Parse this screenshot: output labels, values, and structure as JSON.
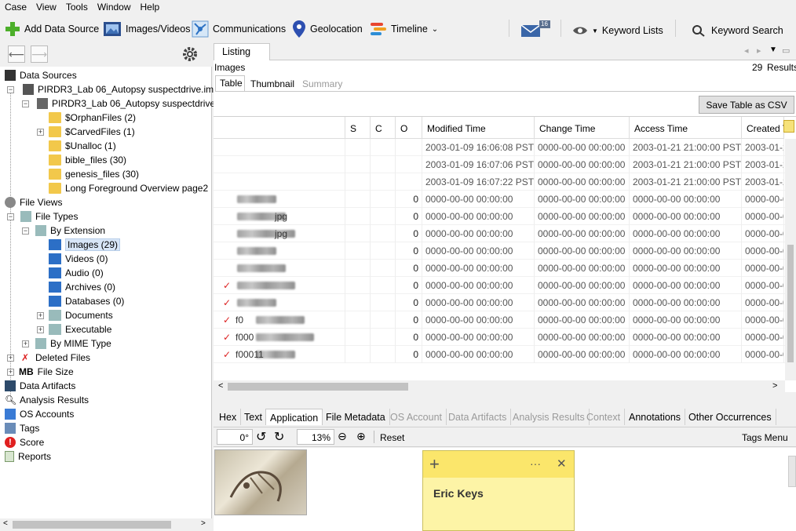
{
  "menu": [
    "Case",
    "View",
    "Tools",
    "Window",
    "Help"
  ],
  "toolbar": {
    "add_data_source": "Add Data Source",
    "images_videos": "Images/Videos",
    "communications": "Communications",
    "geolocation": "Geolocation",
    "timeline": "Timeline",
    "mail_badge": "16",
    "keyword_lists": "Keyword Lists",
    "keyword_search": "Keyword Search"
  },
  "tree": {
    "data_sources": "Data Sources",
    "image_file": "PIRDR3_Lab 06_Autopsy suspectdrive.img",
    "volume": "PIRDR3_Lab 06_Autopsy suspectdrive.i",
    "orphan": "$OrphanFiles (2)",
    "carved": "$CarvedFiles (1)",
    "unalloc": "$Unalloc (1)",
    "bible": "bible_files (30)",
    "genesis": "genesis_files (30)",
    "long_fg": "Long Foreground Overview page2",
    "file_views": "File Views",
    "file_types": "File Types",
    "by_extension": "By Extension",
    "images": "Images (29)",
    "videos": "Videos (0)",
    "audio": "Audio (0)",
    "archives": "Archives (0)",
    "databases": "Databases (0)",
    "documents": "Documents",
    "executable": "Executable",
    "by_mime": "By MIME Type",
    "deleted_files": "Deleted Files",
    "mb": "MB",
    "file_size": "File Size",
    "data_artifacts": "Data Artifacts",
    "analysis_results": "Analysis Results",
    "os_accounts": "OS Accounts",
    "tags": "Tags",
    "score": "Score",
    "reports": "Reports"
  },
  "listing": {
    "tab": "Listing",
    "title": "Images",
    "results_count": "29",
    "results_label": "Results",
    "view_tabs": [
      "Table",
      "Thumbnail",
      "Summary"
    ],
    "save_csv": "Save Table as CSV",
    "columns": [
      "S",
      "C",
      "O",
      "Modified Time",
      "Change Time",
      "Access Time",
      "Created T"
    ],
    "rows": [
      {
        "name": "",
        "o": "",
        "mod": "2003-01-09 16:06:08 PST",
        "chg": "0000-00-00 00:00:00",
        "acc": "2003-01-21 21:00:00 PST",
        "cre": "2003-01-2"
      },
      {
        "name": "",
        "o": "",
        "mod": "2003-01-09 16:07:06 PST",
        "chg": "0000-00-00 00:00:00",
        "acc": "2003-01-21 21:00:00 PST",
        "cre": "2003-01-2"
      },
      {
        "name": "",
        "o": "",
        "mod": "2003-01-09 16:07:22 PST",
        "chg": "0000-00-00 00:00:00",
        "acc": "2003-01-21 21:00:00 PST",
        "cre": "2003-01-2"
      },
      {
        "name": "",
        "o": "0",
        "mod": "0000-00-00 00:00:00",
        "chg": "0000-00-00 00:00:00",
        "acc": "0000-00-00 00:00:00",
        "cre": "0000-00-0"
      },
      {
        "name": "jpg",
        "o": "0",
        "mod": "0000-00-00 00:00:00",
        "chg": "0000-00-00 00:00:00",
        "acc": "0000-00-00 00:00:00",
        "cre": "0000-00-0"
      },
      {
        "name": "jpg",
        "o": "0",
        "mod": "0000-00-00 00:00:00",
        "chg": "0000-00-00 00:00:00",
        "acc": "0000-00-00 00:00:00",
        "cre": "0000-00-0"
      },
      {
        "name": "",
        "o": "0",
        "mod": "0000-00-00 00:00:00",
        "chg": "0000-00-00 00:00:00",
        "acc": "0000-00-00 00:00:00",
        "cre": "0000-00-0"
      },
      {
        "name": "",
        "o": "0",
        "mod": "0000-00-00 00:00:00",
        "chg": "0000-00-00 00:00:00",
        "acc": "0000-00-00 00:00:00",
        "cre": "0000-00-0"
      },
      {
        "name": "",
        "o": "0",
        "mod": "0000-00-00 00:00:00",
        "chg": "0000-00-00 00:00:00",
        "acc": "0000-00-00 00:00:00",
        "cre": "0000-00-0"
      },
      {
        "name": "",
        "o": "0",
        "mod": "0000-00-00 00:00:00",
        "chg": "0000-00-00 00:00:00",
        "acc": "0000-00-00 00:00:00",
        "cre": "0000-00-0"
      },
      {
        "name": "f0",
        "o": "0",
        "mod": "0000-00-00 00:00:00",
        "chg": "0000-00-00 00:00:00",
        "acc": "0000-00-00 00:00:00",
        "cre": "0000-00-0"
      },
      {
        "name": "f000",
        "o": "0",
        "mod": "0000-00-00 00:00:00",
        "chg": "0000-00-00 00:00:00",
        "acc": "0000-00-00 00:00:00",
        "cre": "0000-00-0"
      },
      {
        "name": "f00011",
        "o": "0",
        "mod": "0000-00-00 00:00:00",
        "chg": "0000-00-00 00:00:00",
        "acc": "0000-00-00 00:00:00",
        "cre": "0000-00-0"
      }
    ]
  },
  "lower_tabs": [
    "Hex",
    "Text",
    "Application",
    "File Metadata",
    "OS Account",
    "Data Artifacts",
    "Analysis Results",
    "Context",
    "Annotations",
    "Other Occurrences"
  ],
  "viewer": {
    "rotation": "0°",
    "zoom": "13%",
    "reset": "Reset",
    "tags_menu": "Tags Menu"
  },
  "note": {
    "text": "Eric Keys",
    "plus": "+",
    "more": "···",
    "close": "✕"
  }
}
